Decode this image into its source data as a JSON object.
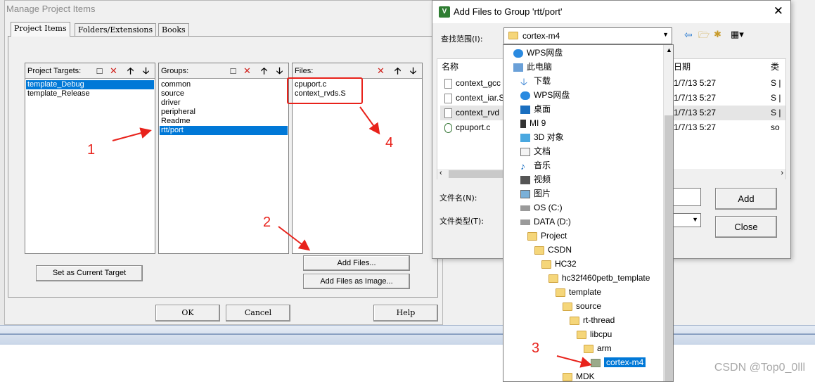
{
  "manage_dialog": {
    "title": "Manage Project Items",
    "tabs": [
      "Project Items",
      "Folders/Extensions",
      "Books"
    ],
    "targets": {
      "label": "Project Targets:",
      "items": [
        "template_Debug",
        "template_Release"
      ]
    },
    "groups": {
      "label": "Groups:",
      "items": [
        "common",
        "source",
        "driver",
        "peripheral",
        "Readme",
        "rtt/port"
      ]
    },
    "files": {
      "label": "Files:",
      "items": [
        "cpuport.c",
        "context_rvds.S"
      ]
    },
    "set_current_label": "Set as Current Target",
    "add_files_label": "Add Files...",
    "add_image_label": "Add Files as Image...",
    "ok_label": "OK",
    "cancel_label": "Cancel",
    "help_label": "Help"
  },
  "annotations": [
    "1",
    "2",
    "3",
    "4"
  ],
  "add_files_dialog": {
    "title": "Add Files to Group 'rtt/port'",
    "look_in_label": "查找范围(I):",
    "look_in_value": "cortex-m4",
    "col_name": "名称",
    "col_date": "日期",
    "col_type": "类",
    "files": [
      {
        "name": "context_gcc",
        "date": "1/7/13 5:27",
        "type": "S |"
      },
      {
        "name": "context_iar.S",
        "date": "1/7/13 5:27",
        "type": "S |"
      },
      {
        "name": "context_rvd",
        "date": "1/7/13 5:27",
        "type": "S |"
      },
      {
        "name": "cpuport.c",
        "date": "1/7/13 5:27",
        "type": "so"
      }
    ],
    "filename_label": "文件名(N):",
    "filetype_label": "文件类型(T):",
    "add_label": "Add",
    "close_label": "Close"
  },
  "dropdown": {
    "items": [
      "WPS网盘",
      "此电脑",
      "下载",
      "WPS网盘",
      "桌面",
      "MI 9",
      "3D 对象",
      "文档",
      "音乐",
      "视频",
      "图片",
      "OS (C:)",
      "DATA (D:)",
      "Project",
      "CSDN",
      "HC32",
      "hc32f460petb_template",
      "template",
      "source",
      "rt-thread",
      "libcpu",
      "arm",
      "cortex-m4",
      "MDK"
    ]
  },
  "watermark": "CSDN @Top0_0lll",
  "colors": {
    "selection": "#0078d7",
    "annotation": "#e8221b"
  }
}
